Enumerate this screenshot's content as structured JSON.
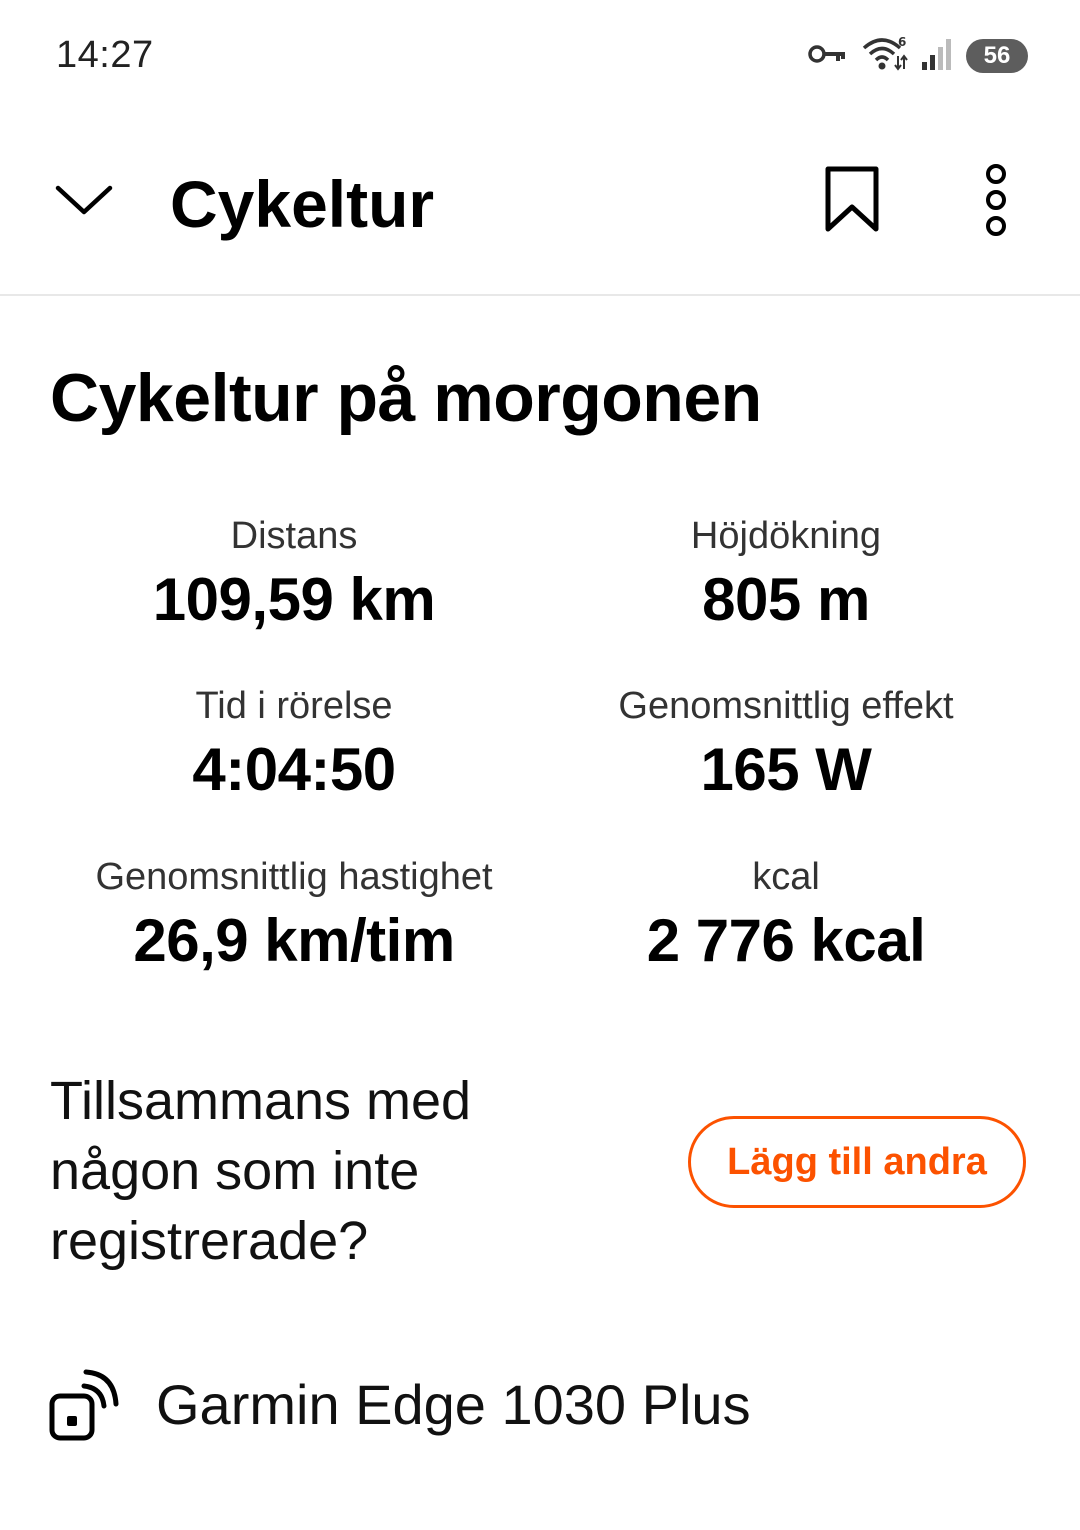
{
  "status_bar": {
    "time": "14:27",
    "battery": "56",
    "icons": [
      "key-icon",
      "wifi-icon",
      "signal-icon",
      "battery-icon"
    ]
  },
  "app_bar": {
    "title": "Cykeltur",
    "icons": [
      "chevron-down-icon",
      "bookmark-icon",
      "more-vertical-icon"
    ]
  },
  "activity": {
    "title": "Cykeltur på morgonen"
  },
  "stats": [
    {
      "label": "Distans",
      "value": "109,59 km"
    },
    {
      "label": "Höjdökning",
      "value": "805 m"
    },
    {
      "label": "Tid i rörelse",
      "value": "4:04:50"
    },
    {
      "label": "Genomsnittlig effekt",
      "value": "165 W"
    },
    {
      "label": "Genomsnittlig hastighet",
      "value": "26,9 km/tim"
    },
    {
      "label": "kcal",
      "value": "2 776 kcal"
    }
  ],
  "together": {
    "text": "Tillsammans med någon som inte registrerade?",
    "button_label": "Lägg till andra"
  },
  "device": {
    "icon": "device-sync-icon",
    "name": "Garmin Edge 1030 Plus"
  },
  "colors": {
    "accent": "#fc5200",
    "text": "#000000",
    "divider": "#e8e8e8"
  }
}
